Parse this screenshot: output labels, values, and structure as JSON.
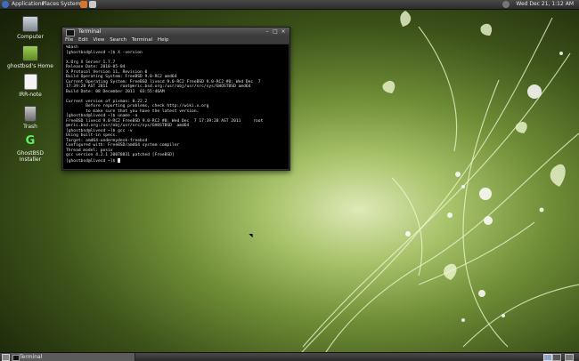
{
  "top_panel": {
    "menus": [
      "Applications",
      "Places",
      "System"
    ],
    "clock": "Wed Dec 21,  1:12 AM"
  },
  "desktop_icons": [
    {
      "label": "Computer",
      "icon": "computer-icon"
    },
    {
      "label": "ghostbsd's Home",
      "icon": "home-folder-icon"
    },
    {
      "label": "IRR-note",
      "icon": "text-file-icon"
    },
    {
      "label": "Trash",
      "icon": "trash-icon"
    },
    {
      "label": "GhostBSD Installer",
      "icon": "ghostbsd-installer-icon"
    }
  ],
  "terminal": {
    "title": "Terminal",
    "menu": [
      "File",
      "Edit",
      "View",
      "Search",
      "Terminal",
      "Help"
    ],
    "lines": [
      "%bash",
      "[ghostbsd@livecd ~]$ X -version",
      "",
      "X.Org X Server 1.7.7",
      "Release Date: 2010-05-04",
      "X Protocol Version 11, Revision 0",
      "Build Operating System: FreeBSD 9.0-RC2 amd64",
      "Current Operating System: FreeBSD livecd 9.0-RC2 FreeBSD 9.0-RC2 #0: Wed Dec  7",
      "17:39:28 AST 2011     root@eric.bsd.org:/usr/obj/usr/src/sys/GHOSTBSD amd64",
      "Build Date: 08 December 2011  03:55:46AM",
      "",
      "Current version of pixman: 0.22.2",
      "        Before reporting problems, check http://wiki.x.org",
      "        to make sure that you have the latest version.",
      "[ghostbsd@livecd ~]$ uname -a",
      "FreeBSD livecd 9.0-RC2 FreeBSD 9.0-RC2 #0: Wed Dec  7 17:39:28 AST 2011     root",
      "@eric.bsd.org:/usr/obj/usr/src/sys/GHOSTBSD  amd64",
      "[ghostbsd@livecd ~]$ gcc -v",
      "Using built-in specs.",
      "Target: amd64-undermydesk-freebsd",
      "Configured with: FreeBSD/amd64 system compiler",
      "Thread model: posix",
      "gcc version 4.2.1 20070831 patched [FreeBSD]",
      "[ghostbsd@livecd ~]$ "
    ]
  },
  "taskbar": {
    "items": [
      "Terminal"
    ]
  },
  "colors": {
    "panel": "#2b2b2b",
    "wallpaper_light": "#dfe9b8",
    "wallpaper_dark": "#141c07"
  }
}
